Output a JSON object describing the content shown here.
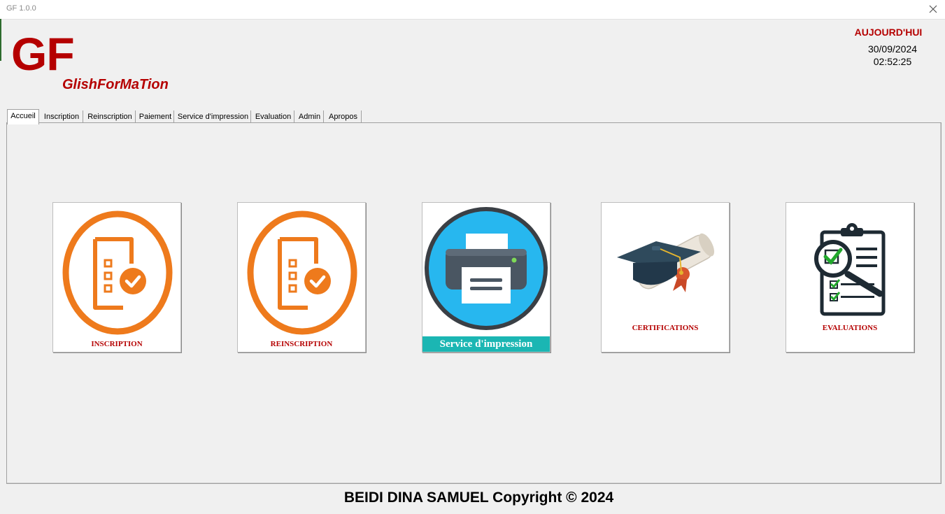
{
  "window": {
    "title": "GF 1.0.0"
  },
  "logo": {
    "text": "GF",
    "subtitle": "GlishForMaTion"
  },
  "clock": {
    "label": "AUJOURD'HUI",
    "date": "30/09/2024",
    "time": "02:52:25"
  },
  "tabs": [
    {
      "label": "Accueil",
      "active": true
    },
    {
      "label": "Inscription"
    },
    {
      "label": "Reinscription"
    },
    {
      "label": "Paiement"
    },
    {
      "label": "Service d'impression"
    },
    {
      "label": "Evaluation"
    },
    {
      "label": "Admin"
    },
    {
      "label": "Apropos"
    }
  ],
  "tiles": {
    "inscription": {
      "label": "INSCRIPTION",
      "icon": "registration-form-icon"
    },
    "reinscription": {
      "label": "REINSCRIPTION",
      "icon": "registration-form-icon"
    },
    "impression": {
      "label": "Service d'impression",
      "icon": "printer-icon"
    },
    "certifications": {
      "label": "CERTIFICATIONS",
      "icon": "graduation-cap-icon"
    },
    "evaluations": {
      "label": "EVALUATIONS",
      "icon": "clipboard-checklist-icon"
    }
  },
  "footer": {
    "text": "BEIDI DINA SAMUEL Copyright © 2024"
  },
  "colors": {
    "brand_red": "#b50000",
    "orange": "#ee7a1c",
    "teal_caption": "#1bb6b3",
    "printer_blue": "#27b7ef"
  }
}
